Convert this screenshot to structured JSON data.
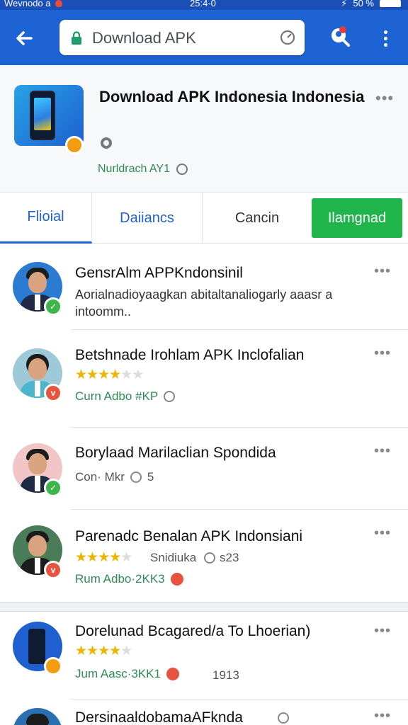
{
  "status_bar": {
    "left_text": "Wevnodo  a",
    "time": "25:4-0",
    "right_text": "50 %"
  },
  "search": {
    "text": "Download APK"
  },
  "app": {
    "title": "Download APK Indonesia Indonesia",
    "subtitle": "Nurldrach AY1"
  },
  "tabs": [
    "Flioial",
    "Daiiancs",
    "Cancin",
    "Ilamgnad"
  ],
  "items": [
    {
      "title": "GensrAlm APPKndonsinil",
      "desc": "Aorialnadioyaagkan abitaltanaliogarly aaasr a intoomm..",
      "badge": ""
    },
    {
      "title": "Betshnade Irohlam APK Inclofalian",
      "meta": "Curn Adbo #KP",
      "rating": 3.5
    },
    {
      "title": "Borylaad Marilaclian Spondida",
      "meta": "Con· Mkr",
      "meta2": "5"
    },
    {
      "title": "Parenadc Benalan APK Indonsiani",
      "meta": "Rum Adbo·2KK3",
      "rating": 3.5,
      "side": "Snidiuka",
      "side2": "s23"
    },
    {
      "title": "Dorelunad Bcagared/a To Lhoerian)",
      "meta": "Jum Aasc·3KK1",
      "rating": 3.5,
      "side": "1913"
    },
    {
      "title": "DersinaaldobamaAFknda"
    }
  ],
  "colors": {
    "app_bar": "#1e63d4",
    "accent_green": "#1fb54a",
    "star": "#f0b400"
  },
  "icons": [
    "back-arrow-icon",
    "lock-icon",
    "refresh-icon",
    "profile-search-icon",
    "more-vert-icon"
  ]
}
